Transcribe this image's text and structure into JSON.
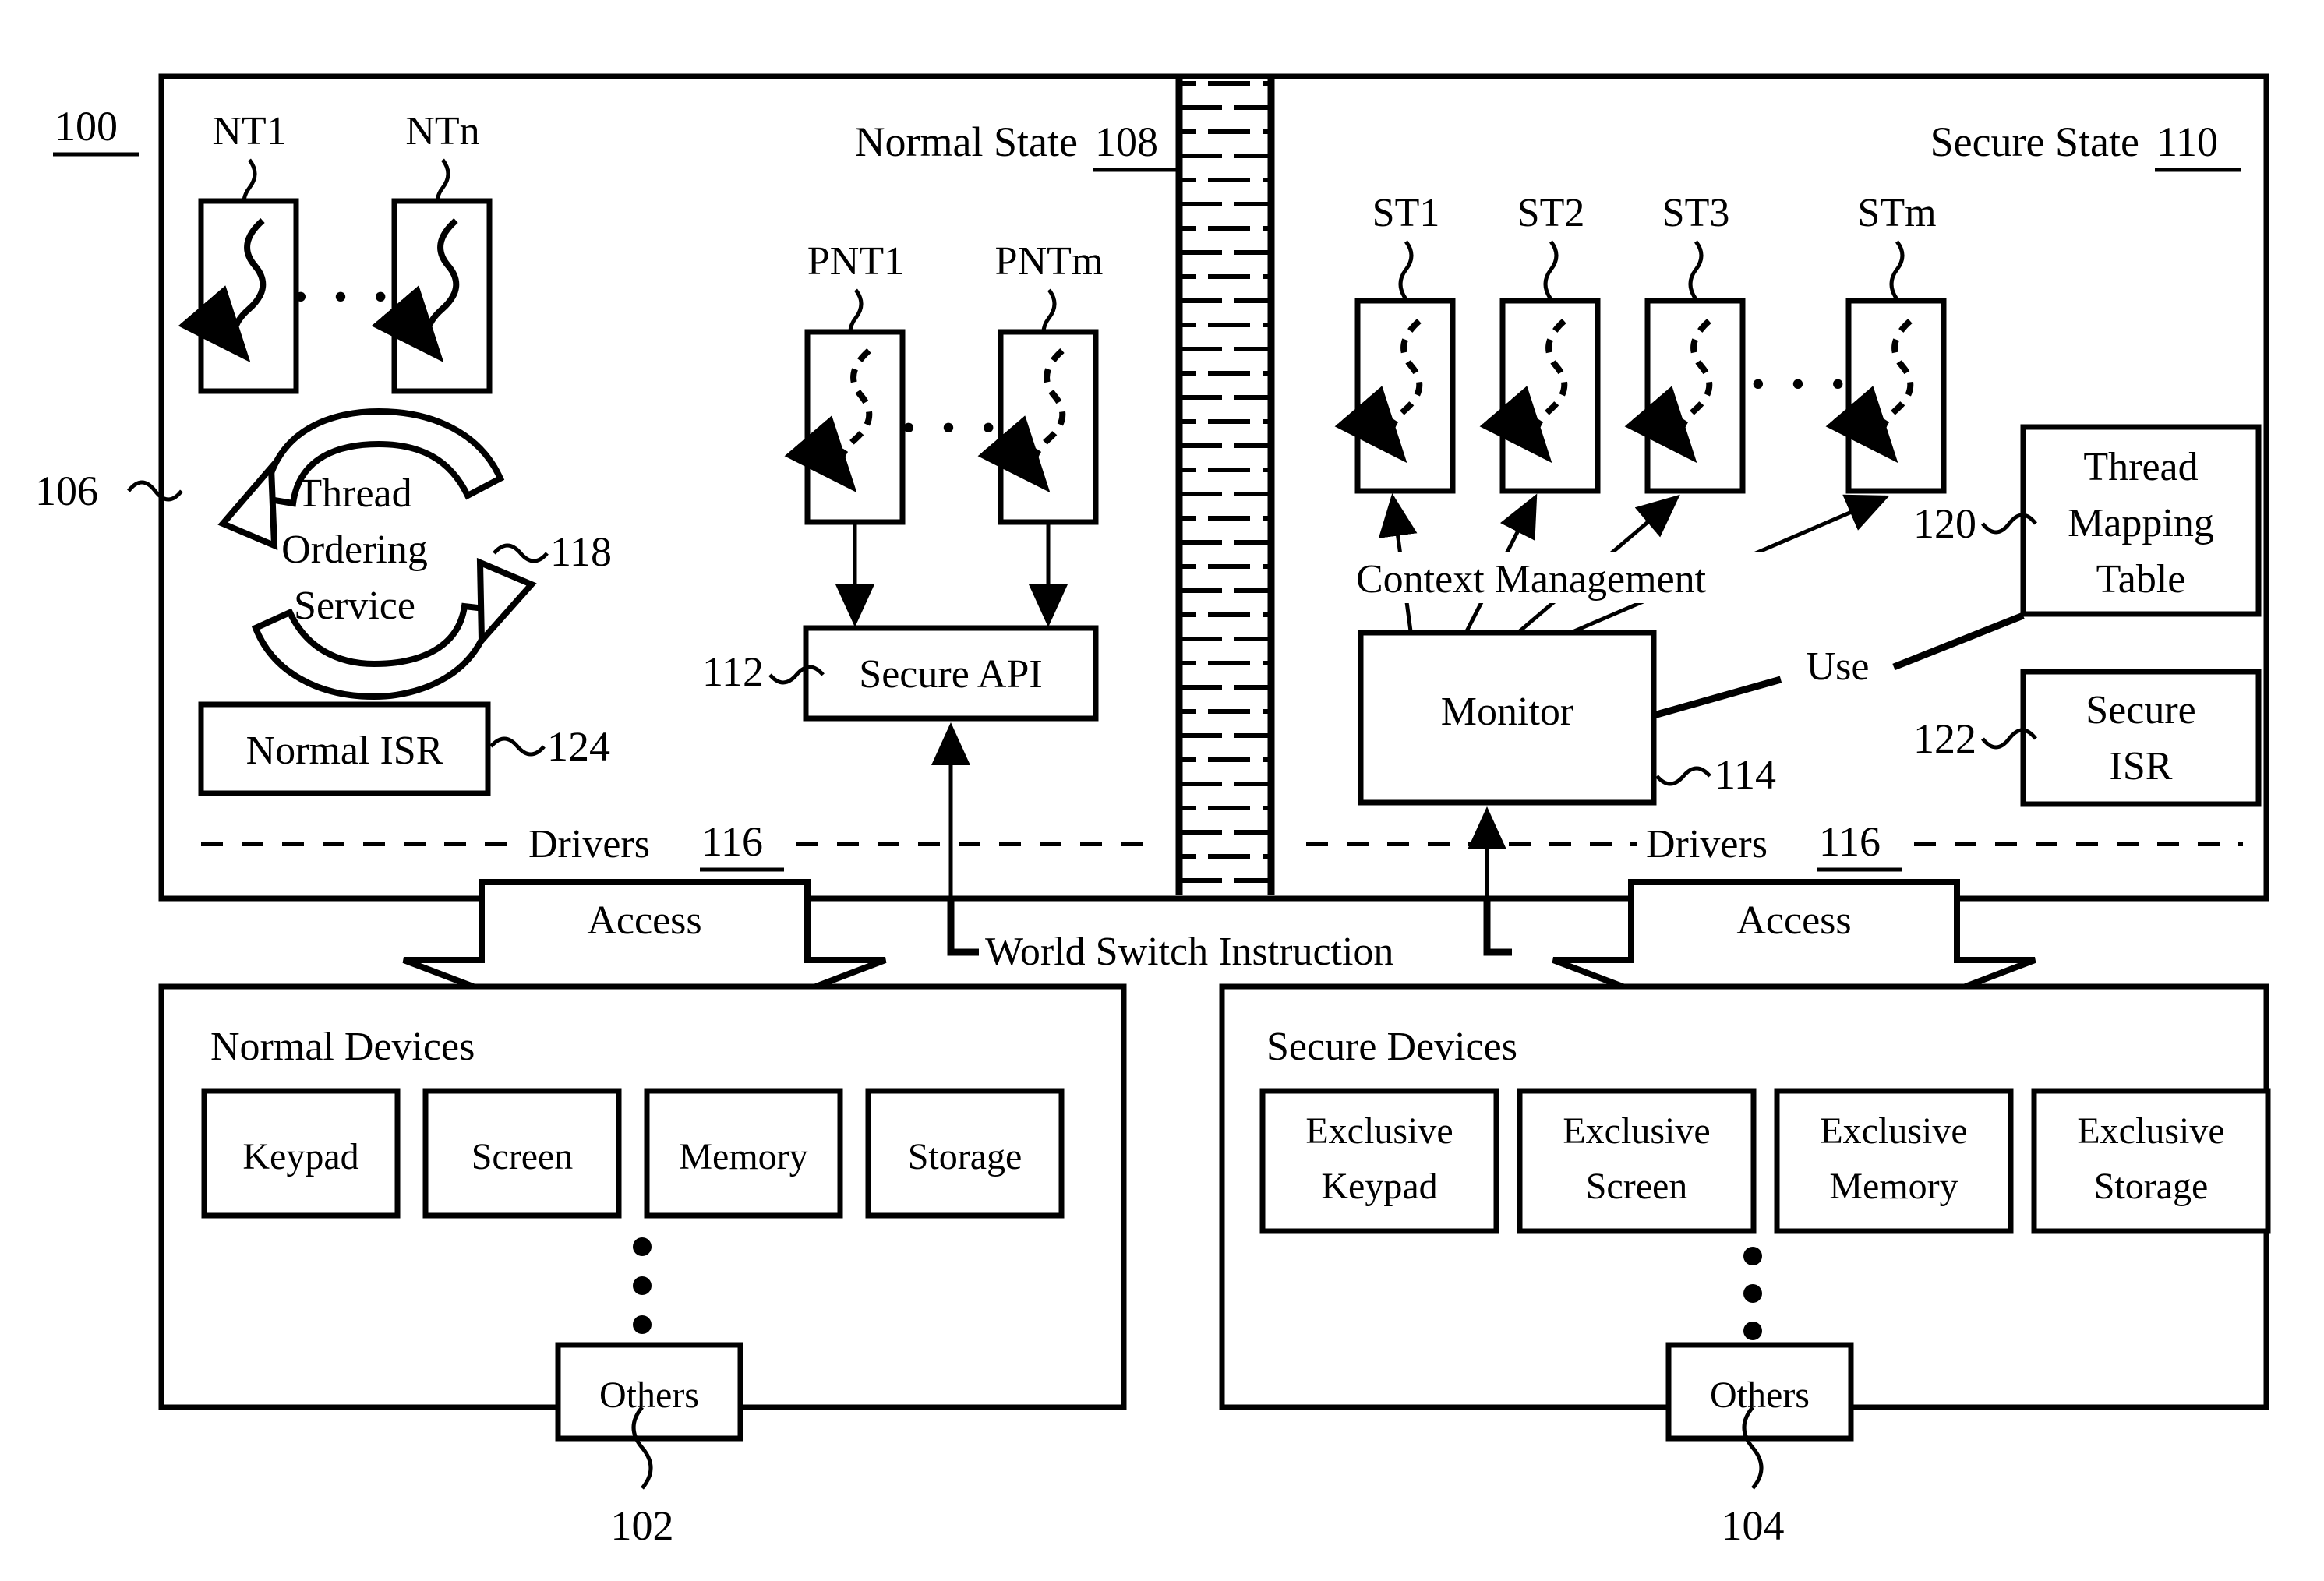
{
  "figure": {
    "ref_main": "100",
    "ref_platform": "106",
    "normal_state": {
      "label": "Normal State",
      "ref": "108"
    },
    "secure_state": {
      "label": "Secure State",
      "ref": "110"
    }
  },
  "normal_threads": {
    "labels": [
      "NT1",
      "NTn"
    ],
    "ellipsis": "• • •"
  },
  "thread_ordering_service": {
    "line1": "Thread",
    "line2": "Ordering",
    "line3": "Service",
    "ref": "118"
  },
  "normal_isr": {
    "label": "Normal ISR",
    "ref": "124"
  },
  "proxy_threads": {
    "labels": [
      "PNT1",
      "PNTm"
    ],
    "ellipsis": "• • •"
  },
  "secure_api": {
    "label": "Secure API",
    "ref": "112"
  },
  "drivers": {
    "label": "Drivers",
    "ref": "116"
  },
  "access": {
    "label": "Access"
  },
  "world_switch": {
    "label": "World Switch Instruction"
  },
  "secure_threads": {
    "labels": [
      "ST1",
      "ST2",
      "ST3",
      "STm"
    ],
    "ellipsis": "• • •"
  },
  "context_management": {
    "label": "Context Management"
  },
  "monitor": {
    "label": "Monitor",
    "ref": "114"
  },
  "use_link": {
    "label": "Use"
  },
  "thread_mapping_table": {
    "line1": "Thread",
    "line2": "Mapping",
    "line3": "Table",
    "ref": "120"
  },
  "secure_isr": {
    "line1": "Secure",
    "line2": "ISR",
    "ref": "122"
  },
  "normal_devices": {
    "title": "Normal Devices",
    "items": [
      "Keypad",
      "Screen",
      "Memory",
      "Storage"
    ],
    "others": "Others",
    "ref": "102"
  },
  "secure_devices": {
    "title": "Secure Devices",
    "items_line1": [
      "Exclusive",
      "Exclusive",
      "Exclusive",
      "Exclusive"
    ],
    "items_line2": [
      "Keypad",
      "Screen",
      "Memory",
      "Storage"
    ],
    "others": "Others",
    "ref": "104"
  },
  "colors": {
    "ink": "#000000",
    "paper": "#ffffff"
  }
}
